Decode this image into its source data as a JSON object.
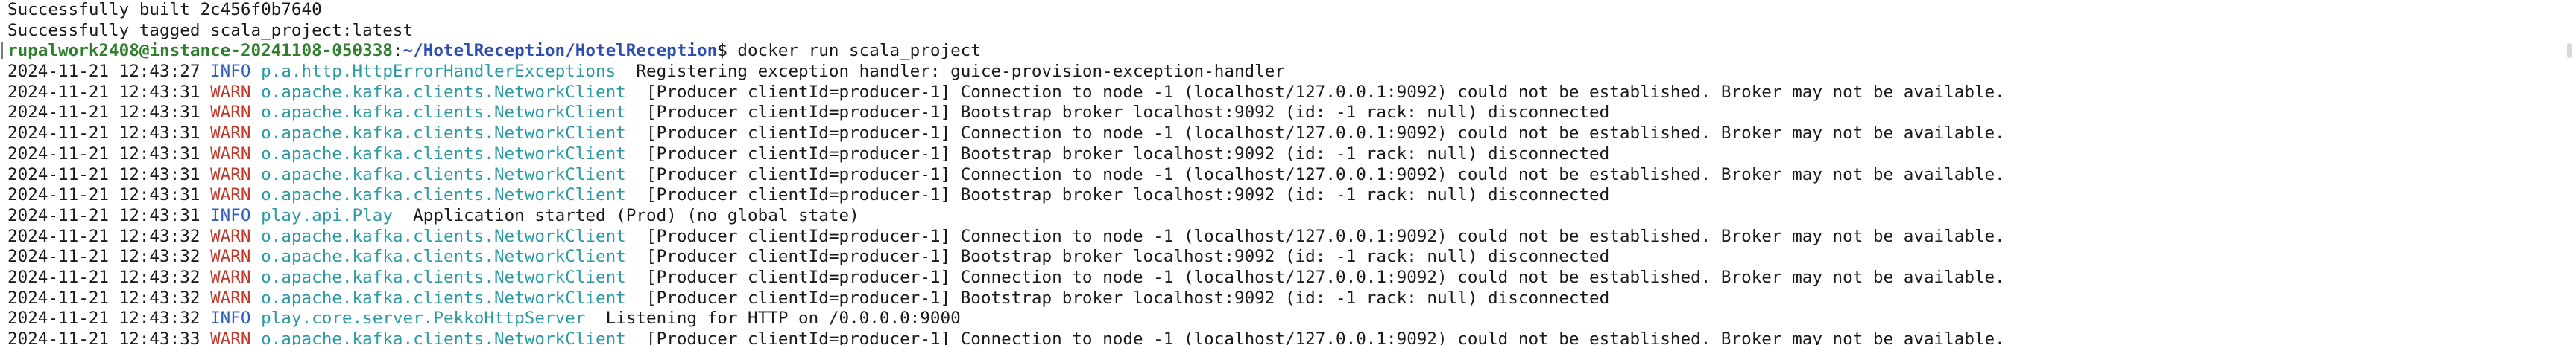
{
  "terminal": {
    "header_lines": [
      "Successfully built 2c456f0b7640",
      "Successfully tagged scala_project:latest"
    ],
    "prompt": {
      "user_host": "rupalwork2408@instance-20241108-050338",
      "separator": ":",
      "path": "~/HotelReception/HotelReception",
      "symbol": "$",
      "command": " docker run scala_project"
    },
    "log_lines": [
      {
        "ts": "2024-11-21 12:43:27",
        "level": "INFO",
        "logger": "p.a.http.HttpErrorHandlerExceptions",
        "msg": "Registering exception handler: guice-provision-exception-handler"
      },
      {
        "ts": "2024-11-21 12:43:31",
        "level": "WARN",
        "logger": "o.apache.kafka.clients.NetworkClient",
        "msg": "[Producer clientId=producer-1] Connection to node -1 (localhost/127.0.0.1:9092) could not be established. Broker may not be available."
      },
      {
        "ts": "2024-11-21 12:43:31",
        "level": "WARN",
        "logger": "o.apache.kafka.clients.NetworkClient",
        "msg": "[Producer clientId=producer-1] Bootstrap broker localhost:9092 (id: -1 rack: null) disconnected"
      },
      {
        "ts": "2024-11-21 12:43:31",
        "level": "WARN",
        "logger": "o.apache.kafka.clients.NetworkClient",
        "msg": "[Producer clientId=producer-1] Connection to node -1 (localhost/127.0.0.1:9092) could not be established. Broker may not be available."
      },
      {
        "ts": "2024-11-21 12:43:31",
        "level": "WARN",
        "logger": "o.apache.kafka.clients.NetworkClient",
        "msg": "[Producer clientId=producer-1] Bootstrap broker localhost:9092 (id: -1 rack: null) disconnected"
      },
      {
        "ts": "2024-11-21 12:43:31",
        "level": "WARN",
        "logger": "o.apache.kafka.clients.NetworkClient",
        "msg": "[Producer clientId=producer-1] Connection to node -1 (localhost/127.0.0.1:9092) could not be established. Broker may not be available."
      },
      {
        "ts": "2024-11-21 12:43:31",
        "level": "WARN",
        "logger": "o.apache.kafka.clients.NetworkClient",
        "msg": "[Producer clientId=producer-1] Bootstrap broker localhost:9092 (id: -1 rack: null) disconnected"
      },
      {
        "ts": "2024-11-21 12:43:31",
        "level": "INFO",
        "logger": "play.api.Play",
        "msg": "Application started (Prod) (no global state)"
      },
      {
        "ts": "2024-11-21 12:43:32",
        "level": "WARN",
        "logger": "o.apache.kafka.clients.NetworkClient",
        "msg": "[Producer clientId=producer-1] Connection to node -1 (localhost/127.0.0.1:9092) could not be established. Broker may not be available."
      },
      {
        "ts": "2024-11-21 12:43:32",
        "level": "WARN",
        "logger": "o.apache.kafka.clients.NetworkClient",
        "msg": "[Producer clientId=producer-1] Bootstrap broker localhost:9092 (id: -1 rack: null) disconnected"
      },
      {
        "ts": "2024-11-21 12:43:32",
        "level": "WARN",
        "logger": "o.apache.kafka.clients.NetworkClient",
        "msg": "[Producer clientId=producer-1] Connection to node -1 (localhost/127.0.0.1:9092) could not be established. Broker may not be available."
      },
      {
        "ts": "2024-11-21 12:43:32",
        "level": "WARN",
        "logger": "o.apache.kafka.clients.NetworkClient",
        "msg": "[Producer clientId=producer-1] Bootstrap broker localhost:9092 (id: -1 rack: null) disconnected"
      },
      {
        "ts": "2024-11-21 12:43:32",
        "level": "INFO",
        "logger": "play.core.server.PekkoHttpServer",
        "msg": "Listening for HTTP on /0.0.0.0:9000"
      },
      {
        "ts": "2024-11-21 12:43:33",
        "level": "WARN",
        "logger": "o.apache.kafka.clients.NetworkClient",
        "msg": "[Producer clientId=producer-1] Connection to node -1 (localhost/127.0.0.1:9092) could not be established. Broker may not be available."
      }
    ]
  }
}
